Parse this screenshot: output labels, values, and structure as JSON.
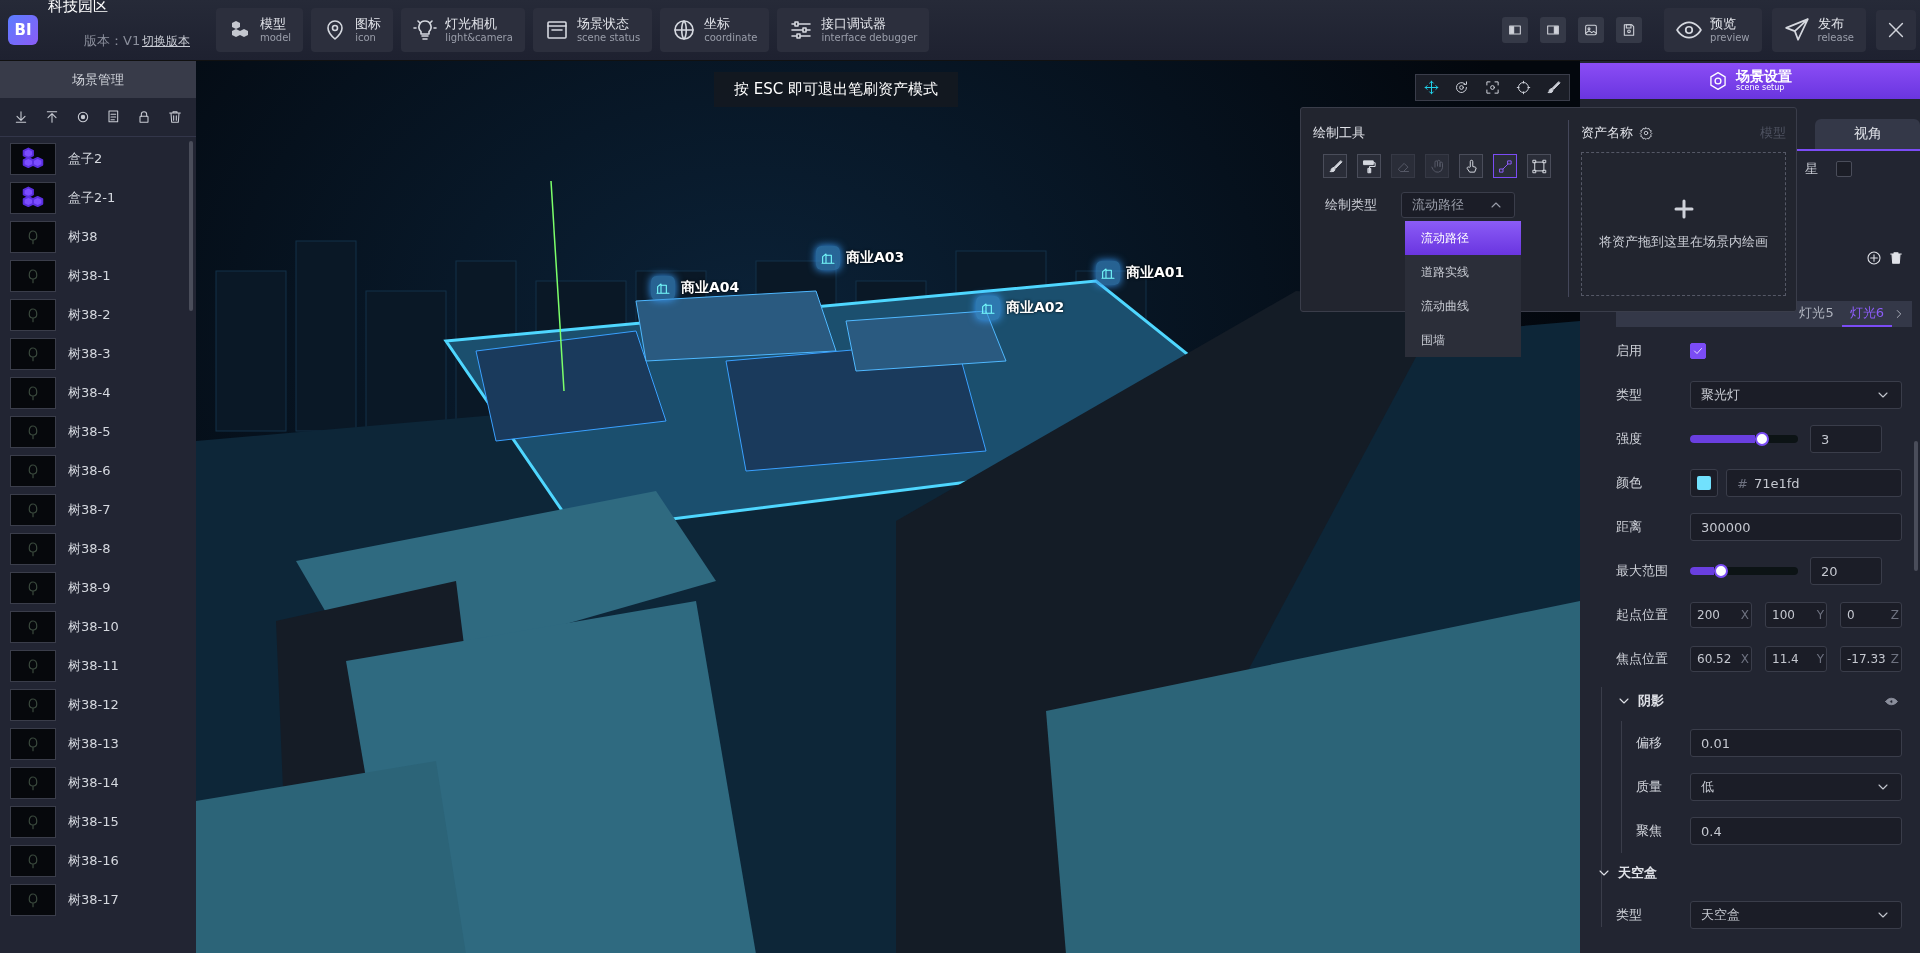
{
  "app": {
    "logo": "BI",
    "title": "科技园区",
    "version": "版本：V1",
    "switch_version": "切换版本"
  },
  "toolbar": [
    {
      "kind": "cubes",
      "label": "模型",
      "sublabel": "model"
    },
    {
      "kind": "pin",
      "label": "图标",
      "sublabel": "icon"
    },
    {
      "kind": "bulb",
      "label": "灯光相机",
      "sublabel": "light&camera"
    },
    {
      "kind": "window",
      "label": "场景状态",
      "sublabel": "scene status"
    },
    {
      "kind": "globe",
      "label": "坐标",
      "sublabel": "coordinate"
    },
    {
      "kind": "sliders",
      "label": "接口调试器",
      "sublabel": "interface debugger"
    }
  ],
  "top_actions": [
    {
      "kind": "eye",
      "label": "预览",
      "sublabel": "preview"
    },
    {
      "kind": "plane",
      "label": "发布",
      "sublabel": "release"
    }
  ],
  "scene_panel": {
    "title": "场景管理",
    "items": [
      {
        "kind": "box",
        "name": "盒子2"
      },
      {
        "kind": "box",
        "name": "盒子2-1"
      },
      {
        "kind": "tree",
        "name": "树38"
      },
      {
        "kind": "tree",
        "name": "树38-1"
      },
      {
        "kind": "tree",
        "name": "树38-2"
      },
      {
        "kind": "tree",
        "name": "树38-3"
      },
      {
        "kind": "tree",
        "name": "树38-4"
      },
      {
        "kind": "tree",
        "name": "树38-5"
      },
      {
        "kind": "tree",
        "name": "树38-6"
      },
      {
        "kind": "tree",
        "name": "树38-7"
      },
      {
        "kind": "tree",
        "name": "树38-8"
      },
      {
        "kind": "tree",
        "name": "树38-9"
      },
      {
        "kind": "tree",
        "name": "树38-10"
      },
      {
        "kind": "tree",
        "name": "树38-11"
      },
      {
        "kind": "tree",
        "name": "树38-12"
      },
      {
        "kind": "tree",
        "name": "树38-13"
      },
      {
        "kind": "tree",
        "name": "树38-14"
      },
      {
        "kind": "tree",
        "name": "树38-15"
      },
      {
        "kind": "tree",
        "name": "树38-16"
      },
      {
        "kind": "tree",
        "name": "树38-17"
      }
    ]
  },
  "esc_hint": "按 ESC 即可退出笔刷资产模式",
  "markers": [
    {
      "label": "商业A04"
    },
    {
      "label": "商业A03"
    },
    {
      "label": "商业A01"
    },
    {
      "label": "商业A02"
    }
  ],
  "transform_tools": [
    {
      "kind": "move",
      "selected": true
    },
    {
      "kind": "rotate",
      "selected": false
    },
    {
      "kind": "scale",
      "selected": false
    },
    {
      "kind": "circle",
      "selected": false
    },
    {
      "kind": "brush",
      "selected": false
    }
  ],
  "draw_panel": {
    "title": "绘制工具",
    "tools": [
      {
        "kind": "brush",
        "selected": false,
        "disabled": false
      },
      {
        "kind": "roller",
        "selected": false,
        "disabled": false
      },
      {
        "kind": "eraser",
        "selected": false,
        "disabled": true
      },
      {
        "kind": "hand",
        "selected": false,
        "disabled": true
      },
      {
        "kind": "pointer",
        "selected": false,
        "disabled": false
      },
      {
        "kind": "line",
        "selected": true,
        "disabled": false
      },
      {
        "kind": "rect",
        "selected": false,
        "disabled": false
      }
    ],
    "type_label": "绘制类型",
    "type_value": "流动路径",
    "dropdown_open": true,
    "options": [
      {
        "label": "流动路径",
        "selected": true
      },
      {
        "label": "道路实线",
        "selected": false
      },
      {
        "label": "流动曲线",
        "selected": false
      },
      {
        "label": "围墙",
        "selected": false
      }
    ],
    "asset_title": "资产名称",
    "asset_tab": "模型",
    "drop_hint": "将资产拖到这里在场景内绘画"
  },
  "right_panel": {
    "header": {
      "label": "场景设置",
      "sublabel": "scene setup"
    },
    "tabs": [
      {
        "label": "视角",
        "selected": false
      }
    ],
    "star": {
      "label": "星",
      "checked": false
    },
    "light_tabs": [
      {
        "label": "灯光5",
        "selected": false
      },
      {
        "label": "灯光6",
        "selected": true
      }
    ],
    "fields": [
      {
        "kind": "checkbox",
        "label": "启用",
        "checked": true
      },
      {
        "kind": "select",
        "label": "类型",
        "value": "聚光灯"
      },
      {
        "kind": "slider",
        "label": "强度",
        "level": 0.6,
        "value": "3"
      },
      {
        "kind": "color",
        "label": "颜色",
        "color": "#71e1fd",
        "hash": "#",
        "value": "71e1fd"
      },
      {
        "kind": "text",
        "label": "距离",
        "value": "300000"
      },
      {
        "kind": "slider",
        "label": "最大范围",
        "level": 0.22,
        "value": "20"
      },
      {
        "kind": "xyz",
        "label": "起点位置",
        "values": [
          {
            "value": "200",
            "axis": "X"
          },
          {
            "value": "100",
            "axis": "Y"
          },
          {
            "value": "0",
            "axis": "Z"
          }
        ]
      },
      {
        "kind": "xyz",
        "label": "焦点位置",
        "values": [
          {
            "value": "60.52",
            "axis": "X"
          },
          {
            "value": "11.4",
            "axis": "Y"
          },
          {
            "value": "-17.33",
            "axis": "Z"
          }
        ]
      }
    ],
    "sections": [
      {
        "title": "阴影",
        "expanded": true,
        "visible_toggle": true,
        "fields": [
          {
            "kind": "text",
            "label": "偏移",
            "value": "0.01"
          },
          {
            "kind": "select",
            "label": "质量",
            "value": "低"
          },
          {
            "kind": "text",
            "label": "聚焦",
            "value": "0.4"
          }
        ]
      },
      {
        "title": "天空盒",
        "expanded": true,
        "visible_toggle": false,
        "fields": [
          {
            "kind": "select",
            "label": "类型",
            "value": "天空盒"
          }
        ]
      }
    ]
  }
}
